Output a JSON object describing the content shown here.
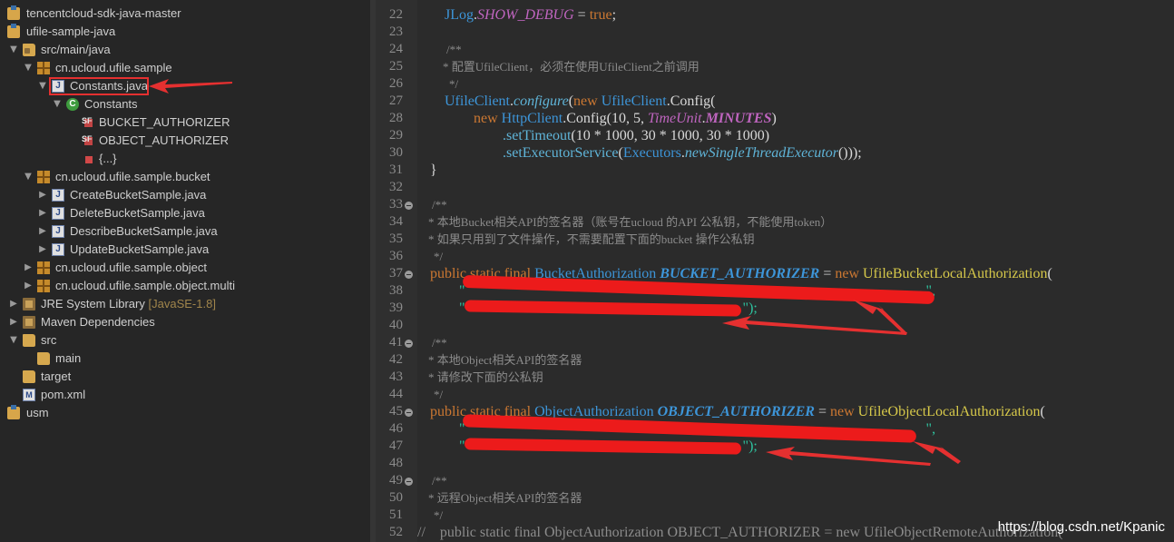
{
  "explorer": {
    "tree": [
      {
        "label": "tencentcloud-sdk-java-master",
        "icon": "project-icon"
      },
      {
        "label": "ufile-sample-java",
        "icon": "project-icon"
      },
      {
        "label": "src/main/java",
        "icon": "source-folder-icon"
      },
      {
        "label": "cn.ucloud.ufile.sample",
        "icon": "package-icon"
      },
      {
        "label": "Constants.java",
        "icon": "java-file-icon"
      },
      {
        "label": "Constants",
        "icon": "class-icon"
      },
      {
        "label": "BUCKET_AUTHORIZER",
        "icon": "field-icon"
      },
      {
        "label": "OBJECT_AUTHORIZER",
        "icon": "field-icon"
      },
      {
        "label": "{...}",
        "icon": "static-block-icon"
      },
      {
        "label": "cn.ucloud.ufile.sample.bucket",
        "icon": "package-icon"
      },
      {
        "label": "CreateBucketSample.java",
        "icon": "java-file-icon"
      },
      {
        "label": "DeleteBucketSample.java",
        "icon": "java-file-icon"
      },
      {
        "label": "DescribeBucketSample.java",
        "icon": "java-file-icon"
      },
      {
        "label": "UpdateBucketSample.java",
        "icon": "java-file-icon"
      },
      {
        "label": "cn.ucloud.ufile.sample.object",
        "icon": "package-icon"
      },
      {
        "label": "cn.ucloud.ufile.sample.object.multi",
        "icon": "package-icon"
      },
      {
        "label": "JRE System Library",
        "decoration": "[JavaSE-1.8]",
        "icon": "library-icon"
      },
      {
        "label": "Maven Dependencies",
        "icon": "library-icon"
      },
      {
        "label": "src",
        "icon": "folder-icon"
      },
      {
        "label": "main",
        "icon": "folder-icon"
      },
      {
        "label": "target",
        "icon": "folder-icon"
      },
      {
        "label": "pom.xml",
        "icon": "xml-file-icon"
      },
      {
        "label": "usm",
        "icon": "project-icon"
      }
    ],
    "java_icon_glyph": "J",
    "class_icon_glyph": "C",
    "field_icon_glyph": "SF",
    "xml_icon_glyph": "M"
  },
  "editor": {
    "line_numbers": [
      "22",
      "23",
      "24",
      "25",
      "26",
      "27",
      "28",
      "29",
      "30",
      "31",
      "32",
      "33",
      "34",
      "35",
      "36",
      "37",
      "38",
      "39",
      "40",
      "41",
      "42",
      "43",
      "44",
      "45",
      "46",
      "47",
      "48",
      "49",
      "50",
      "51",
      "52"
    ],
    "line22": {
      "a": "JLog",
      "b": ".",
      "c": "SHOW_DEBUG",
      "d": " = ",
      "e": "true",
      "f": ";"
    },
    "line24": "/**",
    "line25": "* 配置UfileClient，必须在使用UfileClient之前调用",
    "line26": "*/",
    "line27": {
      "a": "UfileClient",
      "b": ".",
      "c": "configure",
      "d": "(",
      "e": "new",
      "f": " ",
      "g": "UfileClient",
      "h": ".Config("
    },
    "line28": {
      "a": "new",
      "b": " ",
      "c": "HttpClient",
      "d": ".Config(10, 5, ",
      "e": "TimeUnit",
      "f": ".",
      "g": "MINUTES",
      "h": ")"
    },
    "line29": {
      "a": ".setTimeout",
      "b": "(10 * 1000, 30 * 1000, 30 * 1000)"
    },
    "line30": {
      "a": ".setExecutorService",
      "b": "(",
      "c": "Executors",
      "d": ".",
      "e": "newSingleThreadExecutor",
      "f": "()));"
    },
    "line31": "}",
    "line33": "/**",
    "line34": "* 本地Bucket相关API的签名器（账号在ucloud 的API 公私钥，不能使用token）",
    "line35": "* 如果只用到了文件操作，不需要配置下面的bucket 操作公私钥",
    "line36": "*/",
    "line37": {
      "a": "public",
      "b": " ",
      "c": "static",
      "d": " ",
      "e": "final",
      "f": " ",
      "g": "BucketAuthorization",
      "h": " ",
      "i": "BUCKET_AUTHORIZER",
      "j": " = ",
      "k": "new",
      "l": " ",
      "m": "UfileBucketLocalAuthorization",
      "n": "("
    },
    "line38": {
      "a": "\"",
      "b": "\","
    },
    "line39": {
      "a": "\"",
      "b": "\");"
    },
    "line41": "/**",
    "line42": "* 本地Object相关API的签名器",
    "line43": "* 请修改下面的公私钥",
    "line44": "*/",
    "line45": {
      "a": "public",
      "b": " ",
      "c": "static",
      "d": " ",
      "e": "final",
      "f": " ",
      "g": "ObjectAuthorization",
      "h": " ",
      "i": "OBJECT_AUTHORIZER",
      "j": " = ",
      "k": "new",
      "l": " ",
      "m": "UfileObjectLocalAuthorization",
      "n": "("
    },
    "line46": {
      "a": "\"",
      "b": "\","
    },
    "line47": {
      "a": "\"",
      "b": "\");"
    },
    "line49": "/**",
    "line50": "* 远程Object相关API的签名器",
    "line51": "*/",
    "line52": "//    public static final ObjectAuthorization OBJECT_AUTHORIZER = new UfileObjectRemoteAuthorization("
  },
  "watermark": "https://blog.csdn.net/Kpanic",
  "colors": {
    "annotation_red": "#e53030",
    "keyword": "#cc7832",
    "type": "#3d95d8",
    "string": "#2ec4a0"
  }
}
